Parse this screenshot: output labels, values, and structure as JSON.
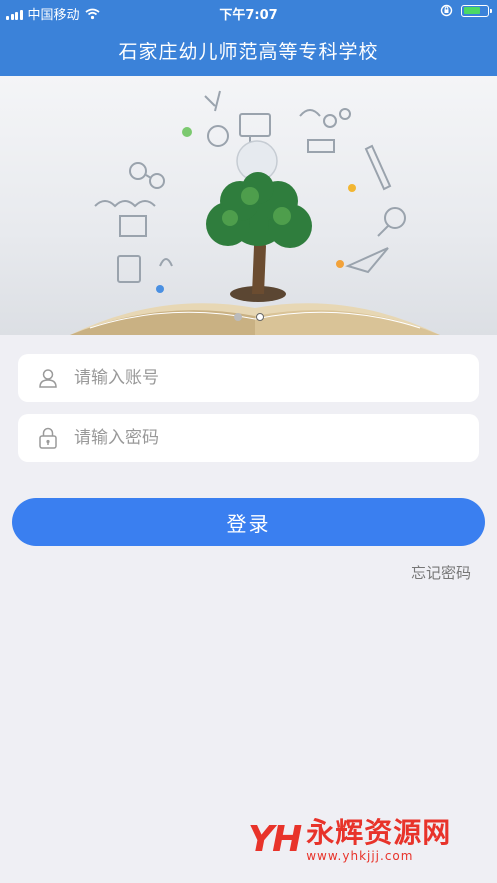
{
  "status_bar": {
    "carrier": "中国移动",
    "time": "下午7:07",
    "battery_level": 0.75,
    "colors": {
      "battery": "#4cd964"
    }
  },
  "header": {
    "title": "石家庄幼儿师范高等专科学校"
  },
  "banner": {
    "slides": 2,
    "active_index": 1
  },
  "login_form": {
    "account": {
      "placeholder": "请输入账号",
      "value": "",
      "icon": "user-icon"
    },
    "password": {
      "placeholder": "请输入密码",
      "value": "",
      "icon": "lock-icon"
    },
    "submit_label": "登录",
    "forgot_label": "忘记密码"
  },
  "watermark": {
    "logo": "YH",
    "title": "永辉资源网",
    "url": "www.yhkjjj.com"
  },
  "colors": {
    "primary": "#3a7ff0",
    "header": "#3b82d9",
    "background": "#efeff4",
    "watermark": "#e8332a"
  }
}
